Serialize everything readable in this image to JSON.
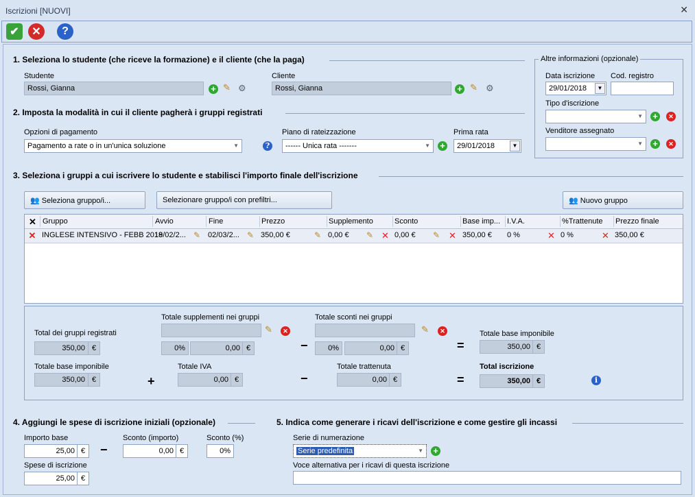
{
  "window": {
    "title": "Iscrizioni [NUOVI]"
  },
  "section1": {
    "title": "1. Seleziona lo studente (che riceve la formazione) e il cliente (che la paga)",
    "student_label": "Studente",
    "student_value": "Rossi, Gianna",
    "client_label": "Cliente",
    "client_value": "Rossi, Gianna"
  },
  "other_info": {
    "title": "Altre informazioni (opzionale)",
    "date_label": "Data iscrizione",
    "date_value": "29/01/2018",
    "reg_label": "Cod. registro",
    "reg_value": "",
    "type_label": "Tipo d'iscrizione",
    "type_value": "",
    "seller_label": "Venditore assegnato",
    "seller_value": ""
  },
  "section2": {
    "title": "2. Imposta la modalità in cui il cliente pagherà i gruppi registrati",
    "payment_label": "Opzioni di pagamento",
    "payment_value": "Pagamento a rate o in un'unica soluzione",
    "plan_label": "Piano di rateizzazione",
    "plan_value": "------ Unica rata -------",
    "first_label": "Prima rata",
    "first_value": "29/01/2018"
  },
  "section3": {
    "title": "3. Seleziona i gruppi a cui iscrivere lo studente e stabilisci l'importo finale dell'iscrizione",
    "btn_select": "Seleziona gruppo/i...",
    "btn_prefilter": "Selezionare gruppo/i con prefiltri...",
    "btn_new": "Nuovo gruppo",
    "columns": [
      "Gruppo",
      "Avvio",
      "Fine",
      "Prezzo",
      "Supplemento",
      "Sconto",
      "Base imp...",
      "I.V.A.",
      "%Trattenute",
      "Prezzo finale"
    ],
    "rows": [
      {
        "gruppo": "INGLESE INTENSIVO - FEBB 2018",
        "avvio": "19/02/2...",
        "fine": "02/03/2...",
        "prezzo": "350,00 €",
        "supplemento": "0,00 €",
        "sconto": "0,00 €",
        "base": "350,00 €",
        "iva": "0 %",
        "trattenute": "0 %",
        "finale": "350,00 €"
      }
    ]
  },
  "totals": {
    "groups_label": "Total dei gruppi registrati",
    "groups_value": "350,00",
    "supp_label": "Totale supplementi nei gruppi",
    "supp_pct": "0%",
    "supp_value": "0,00",
    "disc_label": "Totale sconti nei gruppi",
    "disc_pct": "0%",
    "disc_value": "0,00",
    "base_label_right": "Totale base imponibile",
    "base_value_right": "350,00",
    "base_label": "Totale base imponibile",
    "base_value": "350,00",
    "iva_label": "Totale IVA",
    "iva_value": "0,00",
    "ret_label": "Totale trattenuta",
    "ret_value": "0,00",
    "total_label": "Total iscrizione",
    "total_value": "350,00",
    "euro": "€",
    "minus": "−",
    "plus": "+",
    "equals": "="
  },
  "section4": {
    "title": "4. Aggiungi le spese di iscrizione iniziali (opzionale)",
    "base_label": "Importo base",
    "base_value": "25,00",
    "disc_label": "Sconto (importo)",
    "disc_value": "0,00",
    "pct_label": "Sconto (%)",
    "pct_value": "0%",
    "fee_label": "Spese di iscrizione",
    "fee_value": "25,00"
  },
  "section5": {
    "title": "5. Indica come generare i ricavi dell'iscrizione e come gestire gli incassi",
    "series_label": "Serie di numerazione",
    "series_value": "Serie predefinita",
    "alt_label": "Voce alternativa per i ricavi di questa iscrizione",
    "alt_value": ""
  }
}
